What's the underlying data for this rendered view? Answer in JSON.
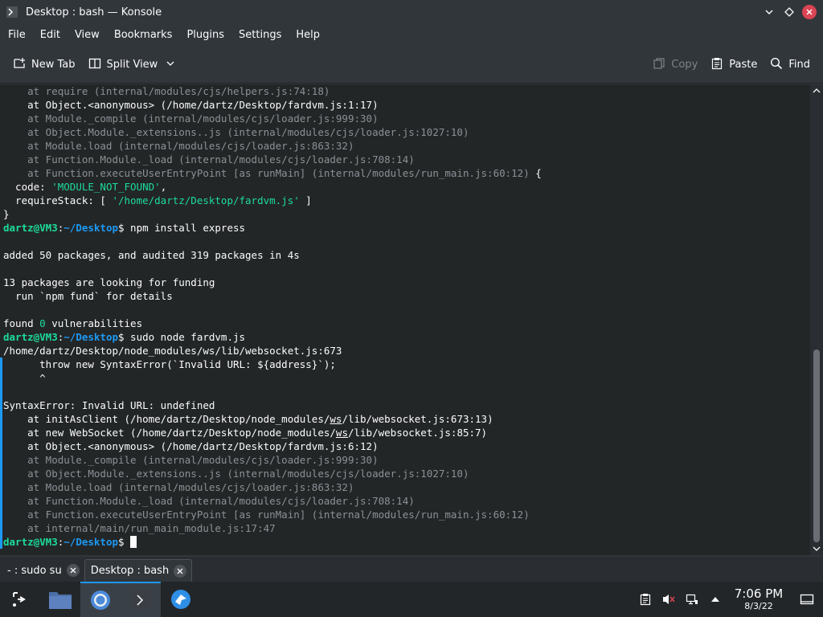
{
  "window": {
    "title": "Desktop : bash — Konsole",
    "icon": "konsole-icon",
    "controls": [
      "minimize-chevron-icon",
      "maximize-diamond-icon",
      "close-icon"
    ]
  },
  "menubar": {
    "items": [
      {
        "label": "File"
      },
      {
        "label": "Edit"
      },
      {
        "label": "View"
      },
      {
        "label": "Bookmarks"
      },
      {
        "label": "Plugins"
      },
      {
        "label": "Settings"
      },
      {
        "label": "Help"
      }
    ]
  },
  "toolbar": {
    "new_tab_label": "New Tab",
    "split_view_label": "Split View",
    "copy_label": "Copy",
    "paste_label": "Paste",
    "find_label": "Find"
  },
  "terminal": {
    "lines": [
      [
        {
          "t": "    at require (internal/modules/cjs/helpers.js:74:18)",
          "c": "g"
        }
      ],
      [
        {
          "t": "    at Object.<anonymous> (/home/dartz/Desktop/fardvm.js:1:17)",
          "c": "w"
        }
      ],
      [
        {
          "t": "    at Module._compile (internal/modules/cjs/loader.js:999:30)",
          "c": "g"
        }
      ],
      [
        {
          "t": "    at Object.Module._extensions..js (internal/modules/cjs/loader.js:1027:10)",
          "c": "g"
        }
      ],
      [
        {
          "t": "    at Module.load (internal/modules/cjs/loader.js:863:32)",
          "c": "g"
        }
      ],
      [
        {
          "t": "    at Function.Module._load (internal/modules/cjs/loader.js:708:14)",
          "c": "g"
        }
      ],
      [
        {
          "t": "    at Function.executeUserEntryPoint [as runMain] (internal/modules/run_main.js:60:12)",
          "c": "g"
        },
        {
          "t": " {",
          "c": "w"
        }
      ],
      [
        {
          "t": "  code: ",
          "c": "w"
        },
        {
          "t": "'MODULE_NOT_FOUND'",
          "c": "grn"
        },
        {
          "t": ",",
          "c": "w"
        }
      ],
      [
        {
          "t": "  requireStack: [ ",
          "c": "w"
        },
        {
          "t": "'/home/dartz/Desktop/fardvm.js'",
          "c": "grn"
        },
        {
          "t": " ]",
          "c": "w"
        }
      ],
      [
        {
          "t": "}",
          "c": "w"
        }
      ],
      [
        {
          "t": "dartz@VM3",
          "c": "prompt-user"
        },
        {
          "t": ":",
          "c": "w"
        },
        {
          "t": "~/Desktop",
          "c": "prompt-path"
        },
        {
          "t": "$ npm install express",
          "c": "w"
        }
      ],
      [
        {
          "t": "",
          "c": "w"
        }
      ],
      [
        {
          "t": "added 50 packages, and audited 319 packages in 4s",
          "c": "w"
        }
      ],
      [
        {
          "t": "",
          "c": "w"
        }
      ],
      [
        {
          "t": "13 packages are looking for funding",
          "c": "w"
        }
      ],
      [
        {
          "t": "  run `npm fund` for details",
          "c": "w"
        }
      ],
      [
        {
          "t": "",
          "c": "w"
        }
      ],
      [
        {
          "t": "found ",
          "c": "w"
        },
        {
          "t": "0",
          "c": "grn"
        },
        {
          "t": " vulnerabilities",
          "c": "w"
        }
      ],
      [
        {
          "t": "dartz@VM3",
          "c": "prompt-user"
        },
        {
          "t": ":",
          "c": "w"
        },
        {
          "t": "~/Desktop",
          "c": "prompt-path"
        },
        {
          "t": "$ sudo node fardvm.js",
          "c": "w"
        }
      ],
      [
        {
          "t": "/home/dartz/Desktop/node_modules/ws/lib/websocket.js:673",
          "c": "w"
        }
      ],
      [
        {
          "t": "      throw new SyntaxError(`Invalid URL: ${address}`);",
          "c": "w"
        }
      ],
      [
        {
          "t": "      ^",
          "c": "w"
        }
      ],
      [
        {
          "t": "",
          "c": "w"
        }
      ],
      [
        {
          "t": "SyntaxError: Invalid URL: undefined",
          "c": "w"
        }
      ],
      [
        {
          "t": "    at initAsClient (/home/dartz/Desktop/node_modules/",
          "c": "w"
        },
        {
          "t": "ws",
          "c": "w ul"
        },
        {
          "t": "/lib/websocket.js:673:13)",
          "c": "w"
        }
      ],
      [
        {
          "t": "    at new WebSocket (/home/dartz/Desktop/node_modules/",
          "c": "w"
        },
        {
          "t": "ws",
          "c": "w ul"
        },
        {
          "t": "/lib/websocket.js:85:7)",
          "c": "w"
        }
      ],
      [
        {
          "t": "    at Object.<anonymous> (/home/dartz/Desktop/fardvm.js:6:12)",
          "c": "w"
        }
      ],
      [
        {
          "t": "    at Module._compile (internal/modules/cjs/loader.js:999:30)",
          "c": "g"
        }
      ],
      [
        {
          "t": "    at Object.Module._extensions..js (internal/modules/cjs/loader.js:1027:10)",
          "c": "g"
        }
      ],
      [
        {
          "t": "    at Module.load (internal/modules/cjs/loader.js:863:32)",
          "c": "g"
        }
      ],
      [
        {
          "t": "    at Function.Module._load (internal/modules/cjs/loader.js:708:14)",
          "c": "g"
        }
      ],
      [
        {
          "t": "    at Function.executeUserEntryPoint [as runMain] (internal/modules/run_main.js:60:12)",
          "c": "g"
        }
      ],
      [
        {
          "t": "    at internal/main/run_main_module.js:17:47",
          "c": "g"
        }
      ],
      [
        {
          "t": "dartz@VM3",
          "c": "prompt-user"
        },
        {
          "t": ":",
          "c": "w"
        },
        {
          "t": "~/Desktop",
          "c": "prompt-path"
        },
        {
          "t": "$ ",
          "c": "w"
        }
      ]
    ]
  },
  "tabs": [
    {
      "label": "- : sudo su",
      "active": false
    },
    {
      "label": "Desktop : bash",
      "active": true
    }
  ],
  "taskbar": {
    "launchers": [
      {
        "name": "application-launcher-icon"
      },
      {
        "name": "file-manager-icon"
      },
      {
        "name": "chromium-browser-icon"
      },
      {
        "name": "konsole-terminal-icon"
      },
      {
        "name": "discover-store-icon"
      }
    ],
    "tray": [
      "clipboard-icon",
      "volume-muted-icon",
      "network-icon",
      "tray-expand-icon"
    ],
    "clock": {
      "time": "7:06 PM",
      "date": "8/3/22"
    },
    "show_desktop": "show-desktop-icon"
  },
  "colors": {
    "accent": "#1d99f3",
    "prompt_user": "#1cdc9a",
    "terminal_bg": "#232627",
    "close_red": "#da4453"
  }
}
